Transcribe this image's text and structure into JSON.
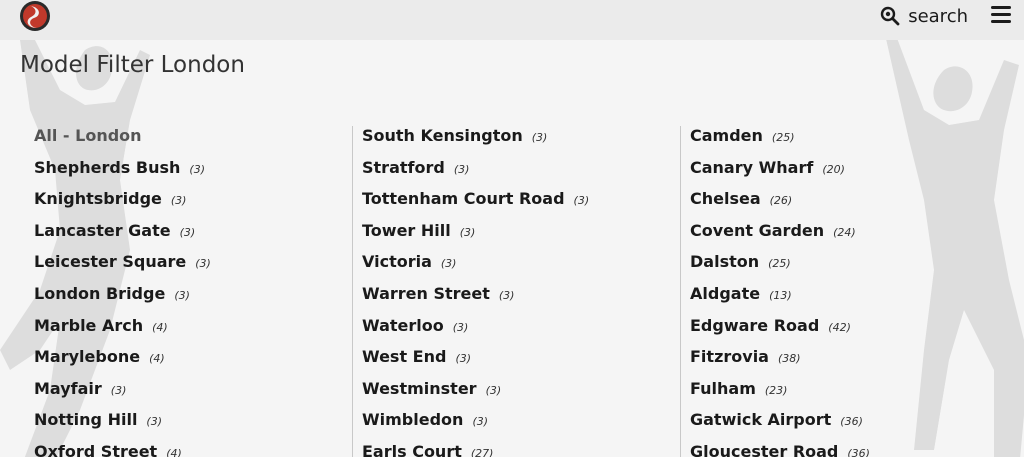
{
  "header": {
    "logo_icon": "red-swirl-logo-icon",
    "search_label": "search",
    "search_icon": "search-icon",
    "menu_icon": "hamburger-menu-icon"
  },
  "page_title": "Model Filter London",
  "columns": [
    [
      {
        "name": "All - London",
        "count": ""
      },
      {
        "name": "Shepherds Bush",
        "count": "(3)"
      },
      {
        "name": "Knightsbridge",
        "count": "(3)"
      },
      {
        "name": "Lancaster Gate",
        "count": "(3)"
      },
      {
        "name": "Leicester Square",
        "count": "(3)"
      },
      {
        "name": "London Bridge",
        "count": "(3)"
      },
      {
        "name": "Marble Arch",
        "count": "(4)"
      },
      {
        "name": "Marylebone",
        "count": "(4)"
      },
      {
        "name": "Mayfair",
        "count": "(3)"
      },
      {
        "name": "Notting Hill",
        "count": "(3)"
      },
      {
        "name": "Oxford Street",
        "count": "(4)"
      }
    ],
    [
      {
        "name": "South Kensington",
        "count": "(3)"
      },
      {
        "name": "Stratford",
        "count": "(3)"
      },
      {
        "name": "Tottenham Court Road",
        "count": "(3)"
      },
      {
        "name": "Tower Hill",
        "count": "(3)"
      },
      {
        "name": "Victoria",
        "count": "(3)"
      },
      {
        "name": "Warren Street",
        "count": "(3)"
      },
      {
        "name": "Waterloo",
        "count": "(3)"
      },
      {
        "name": "West End",
        "count": "(3)"
      },
      {
        "name": "Westminster",
        "count": "(3)"
      },
      {
        "name": "Wimbledon",
        "count": "(3)"
      },
      {
        "name": "Earls Court",
        "count": "(27)"
      }
    ],
    [
      {
        "name": "Camden",
        "count": "(25)"
      },
      {
        "name": "Canary Wharf",
        "count": "(20)"
      },
      {
        "name": "Chelsea",
        "count": "(26)"
      },
      {
        "name": "Covent Garden",
        "count": "(24)"
      },
      {
        "name": "Dalston",
        "count": "(25)"
      },
      {
        "name": "Aldgate",
        "count": "(13)"
      },
      {
        "name": "Edgware Road",
        "count": "(42)"
      },
      {
        "name": "Fitzrovia",
        "count": "(38)"
      },
      {
        "name": "Fulham",
        "count": "(23)"
      },
      {
        "name": "Gatwick Airport",
        "count": "(36)"
      },
      {
        "name": "Gloucester Road",
        "count": "(36)"
      }
    ]
  ]
}
